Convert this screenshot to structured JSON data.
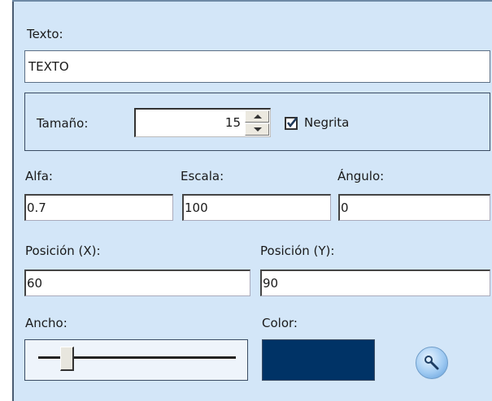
{
  "texto": {
    "label": "Texto:",
    "value": "TEXTO"
  },
  "tamano": {
    "label": "Tamaño:",
    "value": "15"
  },
  "negrita": {
    "label": "Negrita",
    "checked": true
  },
  "alfa": {
    "label": "Alfa:",
    "value": "0.7"
  },
  "escala": {
    "label": "Escala:",
    "value": "100"
  },
  "angulo": {
    "label": "Ángulo:",
    "value": "0"
  },
  "posicion_x": {
    "label": "Posición (X):",
    "value": "60"
  },
  "posicion_y": {
    "label": "Posición (Y):",
    "value": "90"
  },
  "ancho": {
    "label": "Ancho:",
    "level": 0.12
  },
  "color": {
    "label": "Color:",
    "value": "#003366"
  },
  "icons": {
    "color_picker": "magnifier-icon",
    "checkmark": "checkmark-icon"
  },
  "theme": {
    "panel_bg": "#d3e6f8",
    "border": "#3a4c63"
  }
}
